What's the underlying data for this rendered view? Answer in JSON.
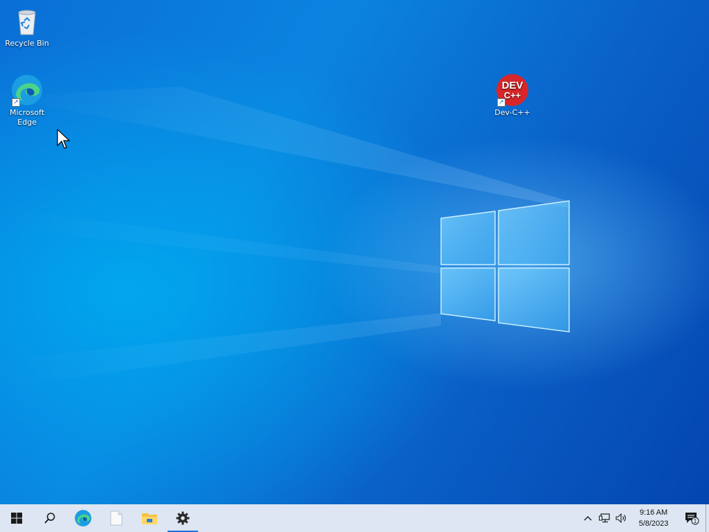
{
  "desktop": {
    "icons": [
      {
        "label": "Recycle Bin",
        "icon": "recycle-bin-icon"
      },
      {
        "label": "Microsoft Edge",
        "icon": "edge-icon"
      },
      {
        "label": "Dev-C++",
        "icon": "devcpp-icon",
        "badge_line1": "DEV",
        "badge_line2": "C++"
      }
    ]
  },
  "taskbar": {
    "buttons": [
      {
        "name": "start",
        "icon": "windows-logo-icon"
      },
      {
        "name": "search",
        "icon": "search-icon"
      },
      {
        "name": "edge",
        "icon": "edge-icon"
      },
      {
        "name": "notepad",
        "icon": "document-icon"
      },
      {
        "name": "file-explorer",
        "icon": "folder-icon"
      },
      {
        "name": "settings",
        "icon": "gear-icon",
        "active": true
      }
    ],
    "tray": {
      "icons": [
        "chevron-up-icon",
        "network-icon",
        "volume-icon"
      ],
      "time": "9:16 AM",
      "date": "5/8/2023",
      "notification_count": "1"
    }
  },
  "colors": {
    "taskbar_bg": "#dde6f2",
    "accent": "#1a73d9",
    "devcpp_red": "#d8262a"
  }
}
